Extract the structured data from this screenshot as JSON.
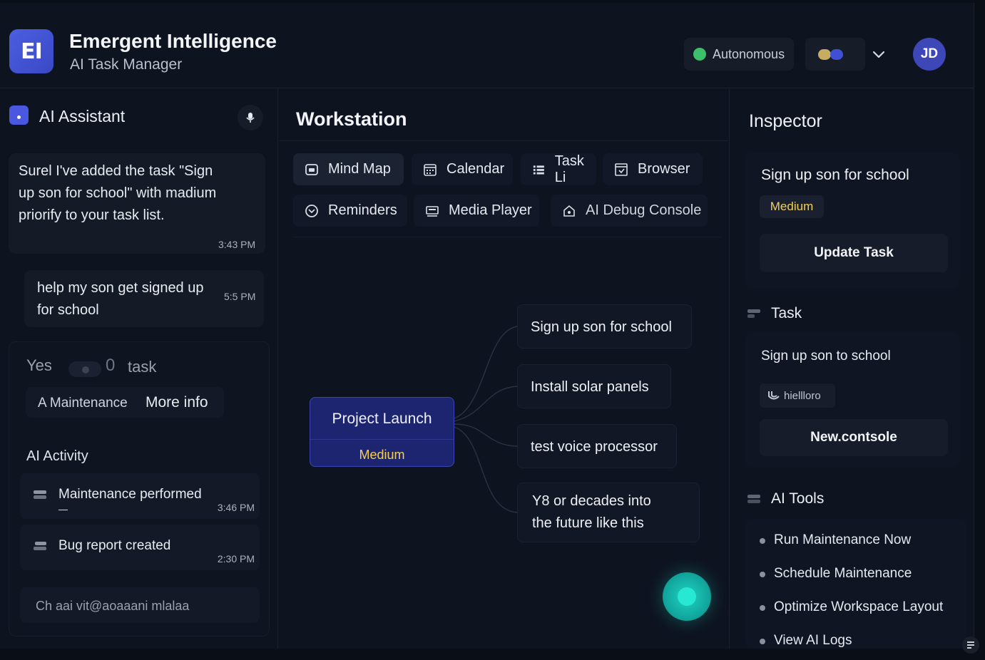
{
  "header": {
    "logo_text": "EI",
    "title": "Emergent Intelligence",
    "subtitle": "AI Task Manager",
    "mode_label": "Autonomous",
    "mode_color": "#3cc06a",
    "avatar_initials": "JD"
  },
  "assistant": {
    "title": "AI Assistant",
    "messages": [
      {
        "text": "Surel I've added the task \"Sign up son for school\" with madium priorify to your task list.",
        "time": "3:43 PM"
      },
      {
        "text": "help my son get signed up for school",
        "time": "5:5 PM"
      }
    ],
    "yes_label": "Yes",
    "zero_label": "0",
    "task_label": "task",
    "maintenance_label": "A Maintenance",
    "more_info_label": "More info",
    "activity_title": "AI Activity",
    "activity": [
      {
        "text": "Maintenance performed",
        "time": "3:46 PM"
      },
      {
        "text": "Bug report created",
        "time": "2:30 PM"
      }
    ],
    "truncated_activity": "Ch aai vit@aoaaani mlalaa"
  },
  "workstation": {
    "title": "Workstation",
    "tabs": [
      {
        "label": "Mind Map",
        "icon": "mind-map-icon"
      },
      {
        "label": "Calendar",
        "icon": "calendar-icon"
      },
      {
        "label": "Task Li",
        "icon": "task-list-icon"
      },
      {
        "label": "Browser",
        "icon": "browser-icon"
      },
      {
        "label": "Reminders",
        "icon": "reminders-icon"
      },
      {
        "label": "Media Player",
        "icon": "media-player-icon"
      },
      {
        "label": "AI Debug Console",
        "icon": "debug-console-icon"
      }
    ],
    "root_node": {
      "title": "Project Launch",
      "priority": "Medium"
    },
    "children": [
      "Sign up son for school",
      "Install solar panels",
      "test voice processor",
      "Y8 or decades into the future like this"
    ]
  },
  "inspector": {
    "title": "Inspector",
    "task_name": "Sign up son for school",
    "priority": "Medium",
    "priority_color": "#f1cf5a",
    "update_label": "Update Task",
    "task_section_title": "Task",
    "task_card_title": "Sign up son to school",
    "chip_label": "hiellloro",
    "console_label": "New.contsole",
    "tools_title": "AI Tools",
    "tools": [
      "Run Maintenance Now",
      "Schedule Maintenance",
      "Optimize Workspace Layout",
      "View AI Logs"
    ]
  }
}
